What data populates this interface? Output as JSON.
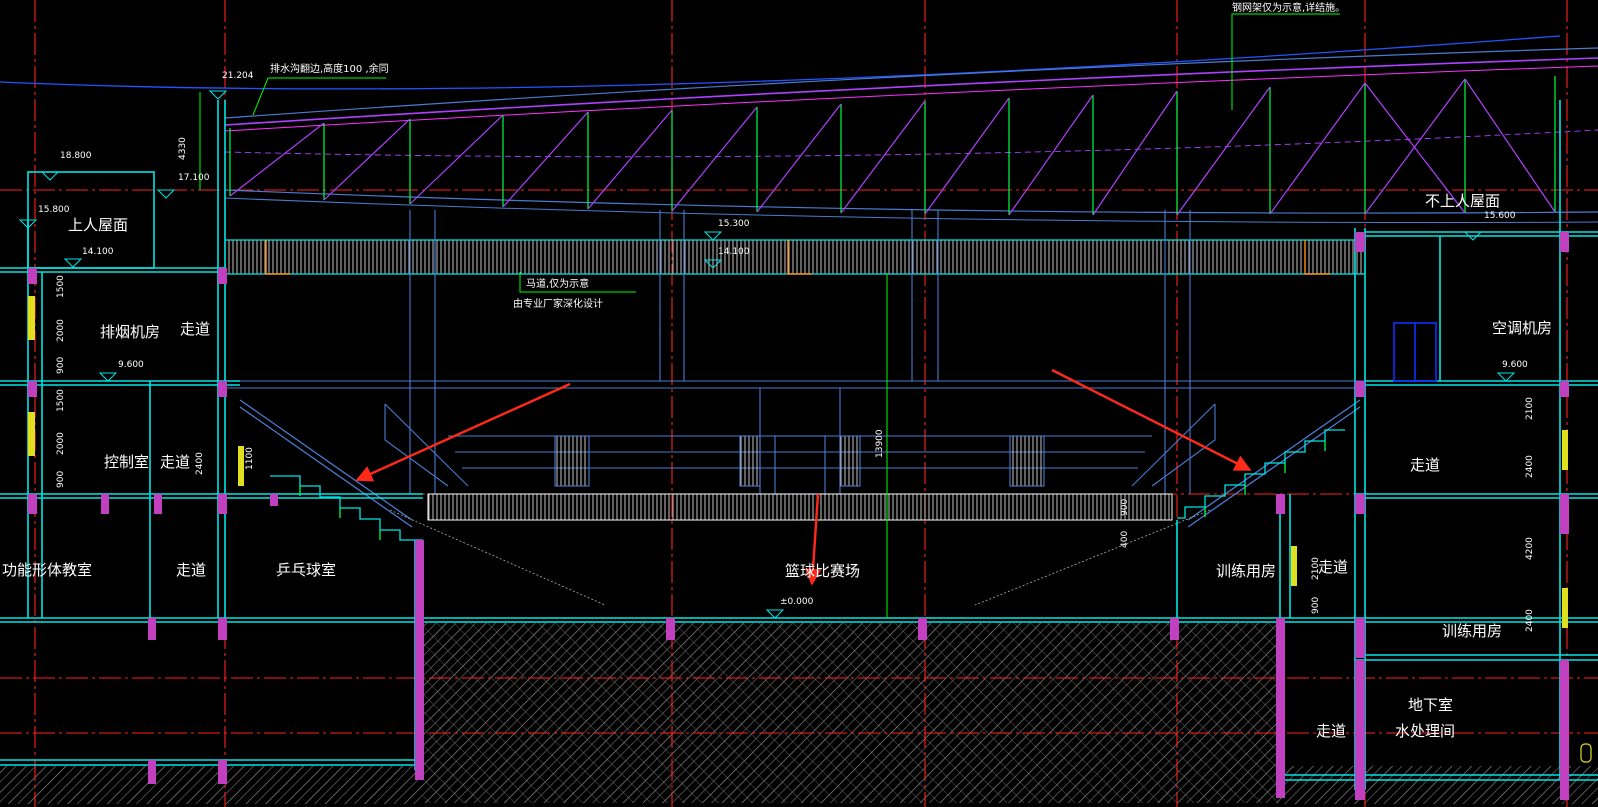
{
  "drawing": {
    "colors": {
      "background": "#000000",
      "grid": "#ff2020",
      "wall": "#00e5e5",
      "structure": "#4a7bd0",
      "roof_truss": "#b040ff",
      "web": "#00ff40",
      "column": "#c040c0",
      "annotation": "#ffffff",
      "arrow": "#ff2a1a",
      "hatch": "#8a8a8a",
      "yellow": "#e0e020",
      "orange": "#ff9010",
      "leader": "#00ff00",
      "blue": "#1030ff"
    },
    "notes": {
      "gutter": "排水沟翻边,高度100 ,余同",
      "steel_truss": "钢网架仅为示意,详结施。",
      "catwalk_1": "马道,仅为示意",
      "catwalk_2": "由专业厂家深化设计"
    },
    "elevations": {
      "e21204": "21.204",
      "e18800": "18.800",
      "e17100": "17.100",
      "e15800": "15.800",
      "e15300": "15.300",
      "e14100_left": "14.100",
      "e14100_mid": "14.100",
      "e15600": "15.600",
      "e9600_left": "9.600",
      "e9600_right": "9.600",
      "e0000": "±0.000"
    },
    "rooms": {
      "roof_accessible": "上人屋面",
      "roof_nonaccessible": "不上人屋面",
      "smoke_exhaust": "排烟机房",
      "corridor_top_left": "走道",
      "control_room": "控制室",
      "corridor_mid_left": "走道",
      "function_classroom": "功能形体教室",
      "corridor_low_left": "走道",
      "table_tennis": "乒乓球室",
      "basketball_hall": "篮球比赛场",
      "training_room_1": "训练用房",
      "corridor_right_low": "走道",
      "ac_room": "空调机房",
      "corridor_right_mid": "走道",
      "training_room_2": "训练用房",
      "basement_1": "地下室",
      "basement_2": "水处理间",
      "corridor_basement": "走道"
    },
    "dimensions": {
      "d4330": "4330",
      "d13900": "13900",
      "d1500a": "1500",
      "d2000a": "2000",
      "d900a": "900",
      "d1500b": "1500",
      "d2000b": "2000",
      "d900b": "900",
      "d2400l": "2400",
      "d1100": "1100",
      "d2100r": "2100",
      "d2400r1": "2400",
      "d4200r": "4200",
      "d2400r2": "2400",
      "d2100r2": "2100",
      "d900r": "900",
      "d900s": "900",
      "d400s": "400"
    }
  }
}
